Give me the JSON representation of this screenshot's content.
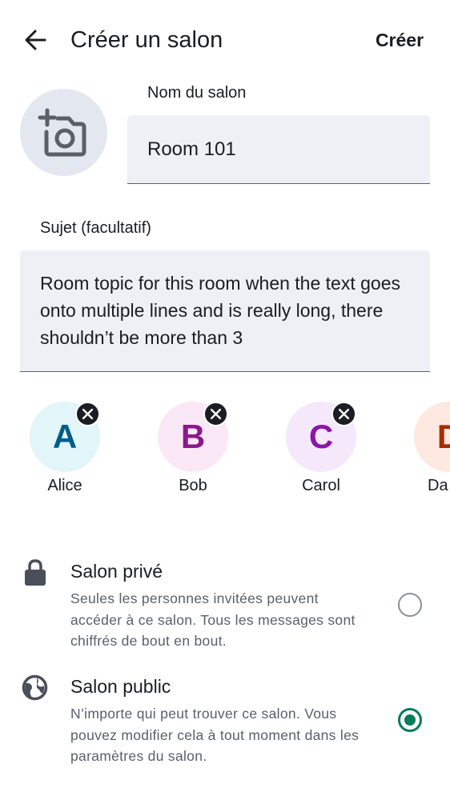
{
  "header": {
    "back_icon": "arrow-left-icon",
    "title": "Créer un salon",
    "create_label": "Créer"
  },
  "avatar_picker": {
    "icon": "add-photo-icon"
  },
  "room_name": {
    "label": "Nom du salon",
    "value": "Room 101"
  },
  "topic": {
    "label": "Sujet (facultatif)",
    "value": "Room topic for this room when the text goes onto multiple lines and is really long, there shouldn’t be more than 3"
  },
  "members": [
    {
      "initial": "A",
      "name": "Alice",
      "bg": "#e2f5f9",
      "fg": "#005c8a"
    },
    {
      "initial": "B",
      "name": "Bob",
      "bg": "#fbe8f7",
      "fg": "#8b1a8d"
    },
    {
      "initial": "C",
      "name": "Carol",
      "bg": "#f6e8fb",
      "fg": "#8a16a8"
    },
    {
      "initial": "D",
      "name": "Da",
      "bg": "#fde9e0",
      "fg": "#a52e00"
    }
  ],
  "options": [
    {
      "icon": "lock-icon",
      "title": "Salon privé",
      "description": "Seules les personnes invitées peuvent accéder à ce salon. Tous les messages sont chiffrés de bout en bout.",
      "selected": false
    },
    {
      "icon": "globe-icon",
      "title": "Salon public",
      "description": "N’importe qui peut trouver ce salon. Vous pouvez modifier cela à tout moment dans les paramètres du salon.",
      "selected": true
    }
  ],
  "colors": {
    "accent": "#0a7b59",
    "field_bg": "#eef0f5",
    "secondary_text": "#5a5f6a"
  }
}
